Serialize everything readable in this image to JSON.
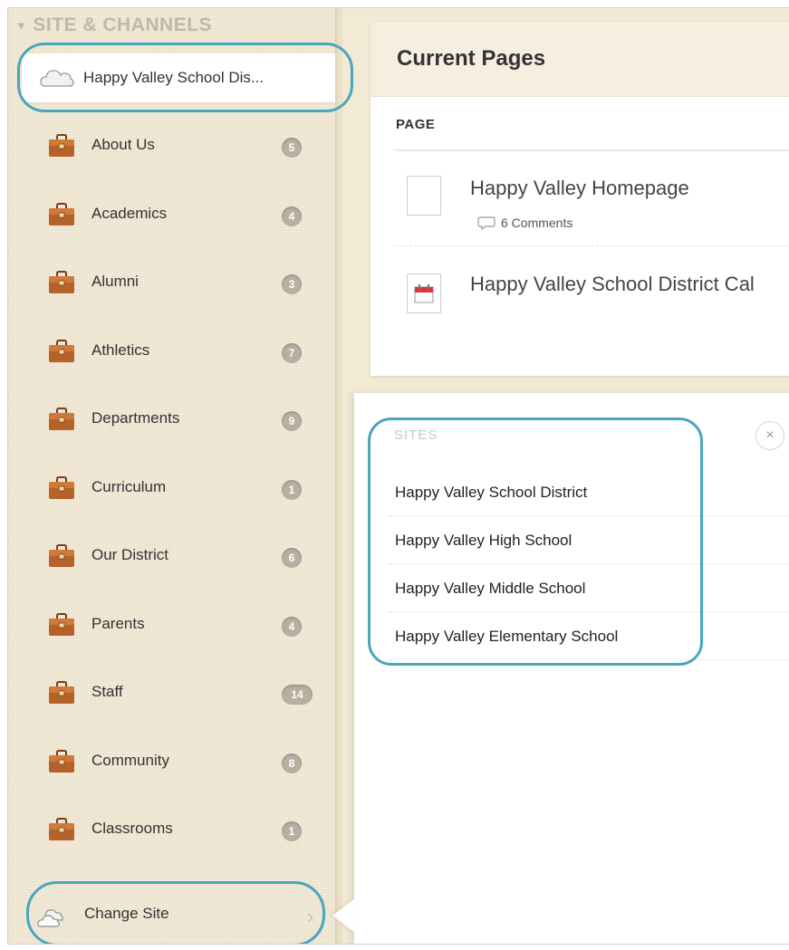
{
  "sidebar": {
    "section_title": "SITE & CHANNELS",
    "current_site": "Happy Valley School Dis...",
    "channels": [
      {
        "label": "About Us",
        "count": "5"
      },
      {
        "label": "Academics",
        "count": "4"
      },
      {
        "label": "Alumni",
        "count": "3"
      },
      {
        "label": "Athletics",
        "count": "7"
      },
      {
        "label": "Departments",
        "count": "9"
      },
      {
        "label": "Curriculum",
        "count": "1"
      },
      {
        "label": "Our District",
        "count": "6"
      },
      {
        "label": "Parents",
        "count": "4"
      },
      {
        "label": "Staff",
        "count": "14"
      },
      {
        "label": "Community",
        "count": "8"
      },
      {
        "label": "Classrooms",
        "count": "1"
      }
    ],
    "change_site_label": "Change Site"
  },
  "current_pages": {
    "title": "Current Pages",
    "column_header": "PAGE",
    "pages": [
      {
        "title": "Happy Valley Homepage",
        "comments": "6 Comments"
      },
      {
        "title": "Happy Valley School District Cal"
      }
    ]
  },
  "sites_popover": {
    "heading": "SITES",
    "close_glyph": "×",
    "sites": [
      "Happy Valley School District",
      "Happy Valley High School",
      "Happy Valley Middle School",
      "Happy Valley Elementary School"
    ]
  },
  "colors": {
    "highlight": "#4aa6bd",
    "sidebar_bg": "#efe6d2",
    "badge": "#b7afa2"
  }
}
